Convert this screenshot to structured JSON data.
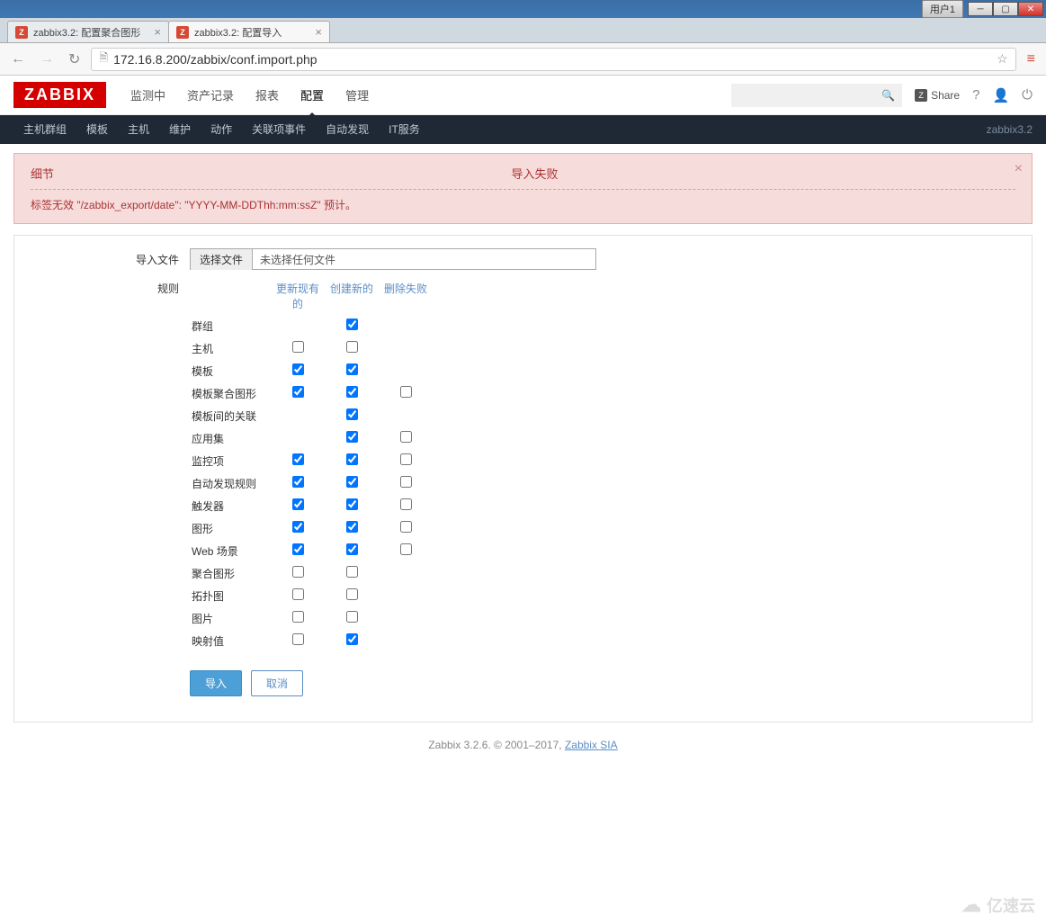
{
  "chrome": {
    "user_label": "用户1",
    "tabs": [
      {
        "title": "zabbix3.2: 配置聚合图形"
      },
      {
        "title": "zabbix3.2: 配置导入"
      }
    ],
    "active_tab_index": 1,
    "url": "172.16.8.200/zabbix/conf.import.php"
  },
  "header": {
    "logo": "ZABBIX",
    "nav": [
      "监测中",
      "资产记录",
      "报表",
      "配置",
      "管理"
    ],
    "active_nav_index": 3,
    "share_label": "Share"
  },
  "subnav": {
    "items": [
      "主机群组",
      "模板",
      "主机",
      "维护",
      "动作",
      "关联项事件",
      "自动发现",
      "IT服务"
    ],
    "right_text": "zabbix3.2"
  },
  "error": {
    "detail_label": "细节",
    "title": "导入失败",
    "body": "标签无效 \"/zabbix_export/date\": \"YYYY-MM-DDThh:mm:ssZ\" 预计。"
  },
  "form": {
    "file_label": "导入文件",
    "file_button": "选择文件",
    "file_status": "未选择任何文件",
    "rules_label": "规则",
    "rules_headers": [
      "",
      "更新现有的",
      "创建新的",
      "删除失败"
    ],
    "rules": [
      {
        "name": "群组",
        "update": null,
        "create": true,
        "delete": null
      },
      {
        "name": "主机",
        "update": false,
        "create": false,
        "delete": null
      },
      {
        "name": "模板",
        "update": true,
        "create": true,
        "delete": null
      },
      {
        "name": "模板聚合图形",
        "update": true,
        "create": true,
        "delete": false
      },
      {
        "name": "模板间的关联",
        "update": null,
        "create": true,
        "delete": null
      },
      {
        "name": "应用集",
        "update": null,
        "create": true,
        "delete": false
      },
      {
        "name": "监控项",
        "update": true,
        "create": true,
        "delete": false
      },
      {
        "name": "自动发现规则",
        "update": true,
        "create": true,
        "delete": false
      },
      {
        "name": "触发器",
        "update": true,
        "create": true,
        "delete": false
      },
      {
        "name": "图形",
        "update": true,
        "create": true,
        "delete": false
      },
      {
        "name": "Web 场景",
        "update": true,
        "create": true,
        "delete": false
      },
      {
        "name": "聚合图形",
        "update": false,
        "create": false,
        "delete": null
      },
      {
        "name": "拓扑图",
        "update": false,
        "create": false,
        "delete": null
      },
      {
        "name": "图片",
        "update": false,
        "create": false,
        "delete": null
      },
      {
        "name": "映射值",
        "update": false,
        "create": true,
        "delete": null
      }
    ],
    "submit_label": "导入",
    "cancel_label": "取消"
  },
  "footer": {
    "text_prefix": "Zabbix 3.2.6. © 2001–2017, ",
    "link_text": "Zabbix SIA"
  },
  "watermark": "亿速云"
}
